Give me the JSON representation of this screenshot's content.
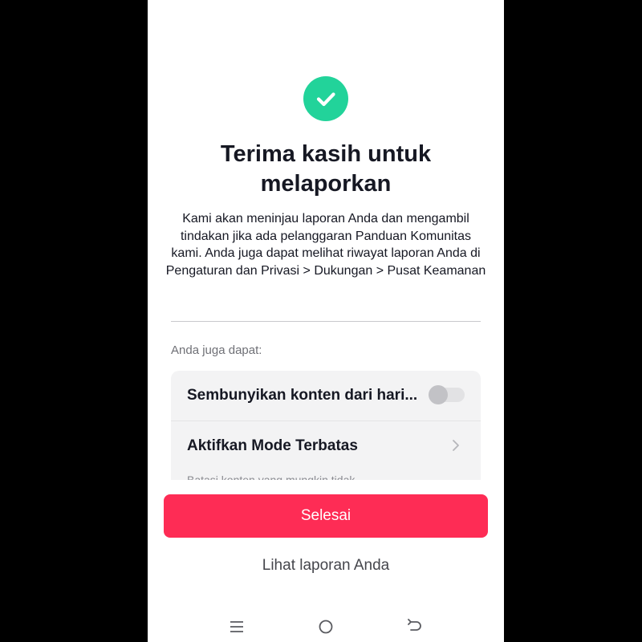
{
  "report_confirmation": {
    "title": "Terima kasih untuk melaporkan",
    "description": "Kami akan meninjau laporan Anda dan mengambil tindakan jika ada pelanggaran Panduan Komunitas kami. Anda juga dapat melihat riwayat laporan Anda di Pengaturan dan Privasi > Dukungan > Pusat Keamanan",
    "section_label": "Anda juga dapat:",
    "options": [
      {
        "label": "Sembunyikan konten dari hari...",
        "control": "toggle",
        "enabled": false
      },
      {
        "label": "Aktifkan Mode Terbatas",
        "control": "chevron-right-icon",
        "subtitle": "Batasi konten yang mungkin tidak..."
      }
    ],
    "done_button": "Selesai",
    "view_reports_link": "Lihat laporan Anda"
  },
  "icons": {
    "status": "check-circle-icon",
    "nav": [
      "menu-icon",
      "home-circle-icon",
      "back-icon"
    ]
  },
  "colors": {
    "success": "#22d39a",
    "primary_button": "#fe2c55",
    "text_primary": "#161823",
    "text_secondary": "#6f7076"
  }
}
